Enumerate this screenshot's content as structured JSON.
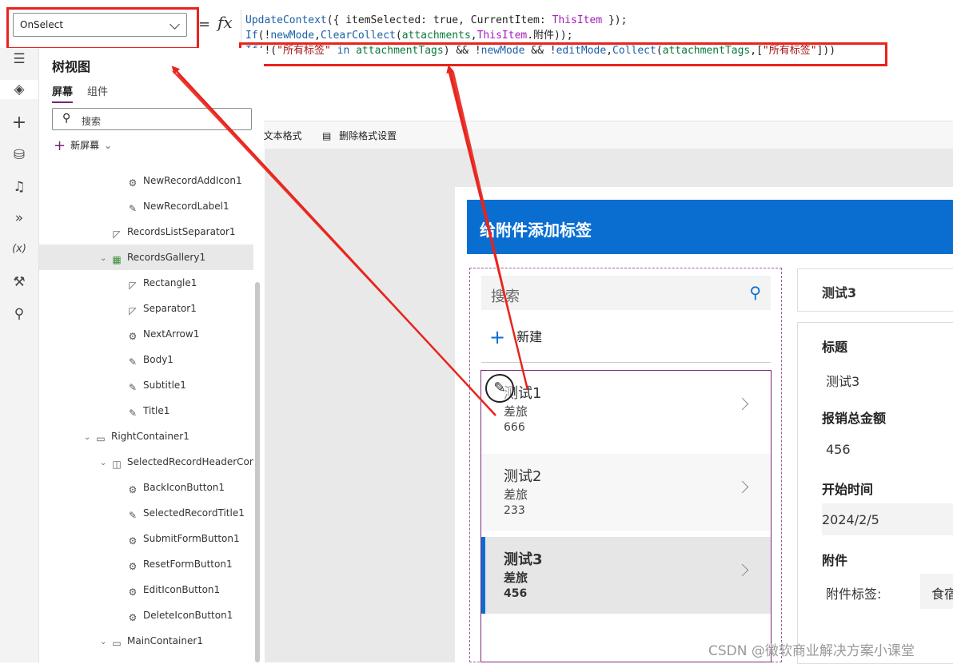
{
  "property": {
    "selected": "OnSelect"
  },
  "formula": {
    "equals": "=",
    "fx": "fx",
    "line1": [
      {
        "t": "UpdateContext",
        "c": "k"
      },
      {
        "t": "({ ",
        "c": "n"
      },
      {
        "t": "itemSelected",
        "c": "n"
      },
      {
        "t": ": ",
        "c": "n"
      },
      {
        "t": "true",
        "c": "n"
      },
      {
        "t": ", ",
        "c": "n"
      },
      {
        "t": "CurrentItem",
        "c": "n"
      },
      {
        "t": ": ",
        "c": "n"
      },
      {
        "t": "ThisItem",
        "c": "p"
      },
      {
        "t": " });",
        "c": "n"
      }
    ],
    "line2": [
      {
        "t": "If",
        "c": "k"
      },
      {
        "t": "(!",
        "c": "n"
      },
      {
        "t": "newMode",
        "c": "k"
      },
      {
        "t": ",",
        "c": "n"
      },
      {
        "t": "ClearCollect",
        "c": "k"
      },
      {
        "t": "(",
        "c": "n"
      },
      {
        "t": "attachments",
        "c": "g"
      },
      {
        "t": ",",
        "c": "n"
      },
      {
        "t": "ThisItem",
        "c": "p"
      },
      {
        "t": ".附件));",
        "c": "n"
      }
    ],
    "line3": [
      {
        "t": "If",
        "c": "k"
      },
      {
        "t": "(!(",
        "c": "n"
      },
      {
        "t": "\"所有标签\"",
        "c": "s"
      },
      {
        "t": " in ",
        "c": "k"
      },
      {
        "t": "attachmentTags",
        "c": "g"
      },
      {
        "t": ") && !",
        "c": "n"
      },
      {
        "t": "newMode",
        "c": "k"
      },
      {
        "t": " && !",
        "c": "n"
      },
      {
        "t": "editMode",
        "c": "k"
      },
      {
        "t": ",",
        "c": "n"
      },
      {
        "t": "Collect",
        "c": "k"
      },
      {
        "t": "(",
        "c": "n"
      },
      {
        "t": "attachmentTags",
        "c": "g"
      },
      {
        "t": ",[",
        "c": "n"
      },
      {
        "t": "\"所有标签\"",
        "c": "s"
      },
      {
        "t": "]))",
        "c": "n"
      }
    ]
  },
  "format_bar": {
    "text_format": "文本格式",
    "remove_format": "删除格式设置"
  },
  "rail_icons": [
    "hamburger-icon",
    "layers-icon",
    "plus-icon",
    "database-icon",
    "media-icon",
    "power-automate-icon",
    "variables-icon",
    "tools-icon",
    "search-icon"
  ],
  "rail_variables_label": "(x)",
  "tree": {
    "title": "树视图",
    "tabs": {
      "screens": "屏幕",
      "components": "组件"
    },
    "search_placeholder": "搜索",
    "new_screen": "新屏幕",
    "nodes": [
      {
        "label": "NewRecordAddIcon1",
        "icon": "icon-control",
        "indent": 2
      },
      {
        "label": "NewRecordLabel1",
        "icon": "label",
        "indent": 2
      },
      {
        "label": "RecordsListSeparator1",
        "icon": "shape",
        "indent": 1
      },
      {
        "label": "RecordsGallery1",
        "icon": "gallery",
        "indent": 1,
        "caret": true,
        "selected": true
      },
      {
        "label": "Rectangle1",
        "icon": "shape",
        "indent": 2
      },
      {
        "label": "Separator1",
        "icon": "shape",
        "indent": 2
      },
      {
        "label": "NextArrow1",
        "icon": "icon-control",
        "indent": 2
      },
      {
        "label": "Body1",
        "icon": "label",
        "indent": 2
      },
      {
        "label": "Subtitle1",
        "icon": "label",
        "indent": 2
      },
      {
        "label": "Title1",
        "icon": "label",
        "indent": 2
      },
      {
        "label": "RightContainer1",
        "icon": "vcontainer",
        "indent": 0,
        "caret": true
      },
      {
        "label": "SelectedRecordHeaderCon",
        "icon": "hcontainer",
        "indent": 1,
        "caret": true
      },
      {
        "label": "BackIconButton1",
        "icon": "icon-control",
        "indent": 2
      },
      {
        "label": "SelectedRecordTitle1",
        "icon": "label",
        "indent": 2
      },
      {
        "label": "SubmitFormButton1",
        "icon": "icon-control",
        "indent": 2
      },
      {
        "label": "ResetFormButton1",
        "icon": "icon-control",
        "indent": 2
      },
      {
        "label": "EditIconButton1",
        "icon": "icon-control",
        "indent": 2
      },
      {
        "label": "DeleteIconButton1",
        "icon": "icon-control",
        "indent": 2
      },
      {
        "label": "MainContainer1",
        "icon": "vcontainer",
        "indent": 1,
        "caret": true
      }
    ]
  },
  "app": {
    "header": "给附件添加标签",
    "search_placeholder": "搜索",
    "new_label": "新建",
    "gallery": [
      {
        "title": "测试1",
        "subtitle": "差旅",
        "body": "666"
      },
      {
        "title": "测试2",
        "subtitle": "差旅",
        "body": "233"
      },
      {
        "title": "测试3",
        "subtitle": "差旅",
        "body": "456"
      }
    ],
    "selected_title": "测试3",
    "form": {
      "title_label": "标题",
      "title_value": "测试3",
      "amount_label": "报销总金额",
      "amount_value": "456",
      "start_label": "开始时间",
      "start_value": "2024/2/5",
      "attach_label": "附件",
      "tag_label": "附件标签:",
      "tag_value": "食宿"
    }
  },
  "watermark": "CSDN @微软商业解决方案小课堂",
  "colors": {
    "accent": "#0a6ed1",
    "annotation": "#e8241c",
    "purple": "#742774"
  }
}
